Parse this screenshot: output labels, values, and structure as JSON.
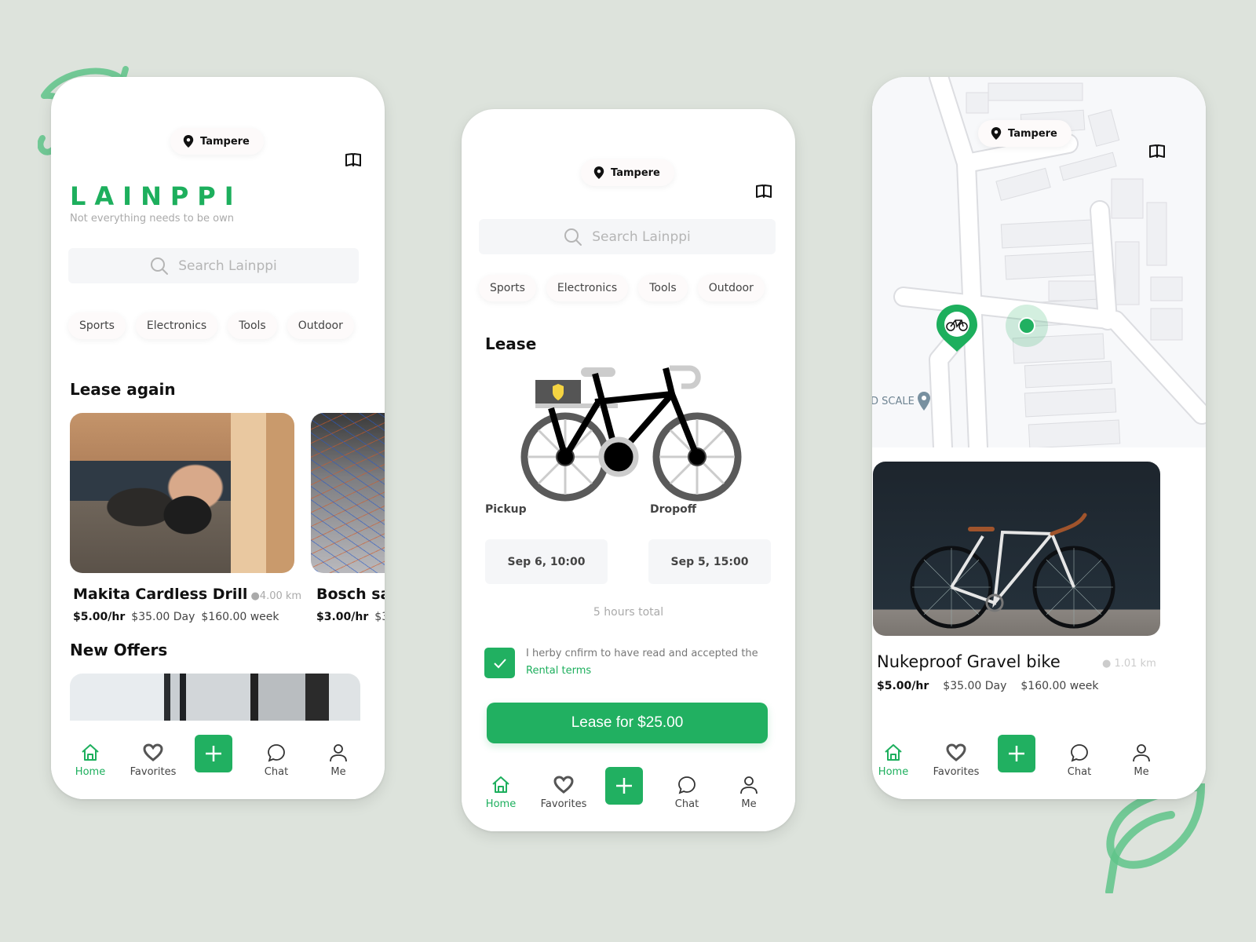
{
  "brand": {
    "name": "LAINPPI",
    "tagline": "Not everything needs to be own",
    "accent_color": "#1daf5d"
  },
  "common": {
    "location": "Tampere",
    "search_placeholder": "Search Lainppi",
    "categories": [
      "Sports",
      "Electronics",
      "Tools",
      "Outdoor"
    ],
    "nav": {
      "home": "Home",
      "favorites": "Favorites",
      "add": "+",
      "chat": "Chat",
      "me": "Me"
    }
  },
  "home_screen": {
    "lease_again_title": "Lease again",
    "items": [
      {
        "title": "Makita Cardless Drill",
        "distance": "4.00 km",
        "price_hr": "$5.00/hr",
        "price_day": "$35.00 Day",
        "price_week": "$160.00 week"
      },
      {
        "title": "Bosch sa",
        "price_hr": "$3.00/hr",
        "price_day": "$3"
      }
    ],
    "new_offers_title": "New Offers"
  },
  "lease_screen": {
    "title": "Lease",
    "pickup_label": "Pickup",
    "dropoff_label": "Dropoff",
    "pickup_value": "Sep 6,  10:00",
    "dropoff_value": "Sep 5,  15:00",
    "total": "5 hours total",
    "terms_text": "I herby cnfirm to have read and accepted the",
    "terms_link": "Rental terms",
    "terms_checked": true,
    "lease_button": "Lease for $25.00"
  },
  "map_screen": {
    "map_label": "D SCALE",
    "item": {
      "title": "Nukeproof Gravel bike",
      "distance": "1.01 km",
      "price_hr": "$5.00/hr",
      "price_day": "$35.00 Day",
      "price_week": "$160.00 week"
    }
  }
}
